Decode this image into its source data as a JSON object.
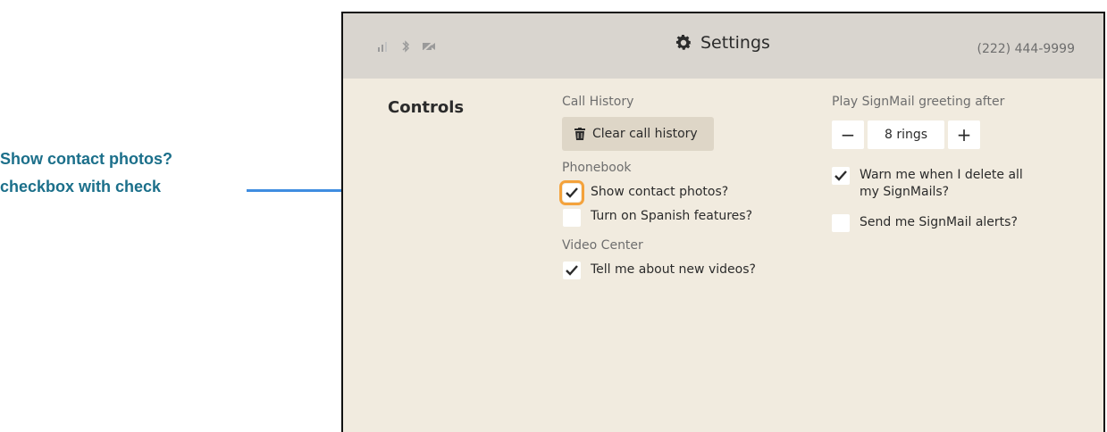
{
  "callout": {
    "line1": "Show contact photos?",
    "line2": "checkbox with check"
  },
  "header": {
    "title": "Settings",
    "phone": "(222) 444-9999"
  },
  "status_icons": [
    "signal-icon",
    "bluetooth-icon",
    "video-off-icon"
  ],
  "section": "Controls",
  "call_history": {
    "label": "Call History",
    "clear_button": "Clear call history"
  },
  "phonebook": {
    "label": "Phonebook",
    "items": [
      {
        "label": "Show contact photos?",
        "checked": true
      },
      {
        "label": "Turn on Spanish features?",
        "checked": false
      }
    ]
  },
  "video_center": {
    "label": "Video Center",
    "items": [
      {
        "label": "Tell me about new videos?",
        "checked": true
      }
    ]
  },
  "signmail": {
    "greeting_label": "Play SignMail greeting after",
    "minus": "−",
    "rings": "8 rings",
    "plus": "+",
    "warn_line1": "Warn me when I delete all",
    "warn_line2": "my SignMails?",
    "warn_checked": true,
    "alerts_label": "Send me SignMail alerts?",
    "alerts_checked": false
  },
  "colors": {
    "accent_focus": "#f4a23b",
    "callout": "#1b6f8a",
    "arrow": "#3f8de0",
    "background": "#f1ebdf"
  }
}
